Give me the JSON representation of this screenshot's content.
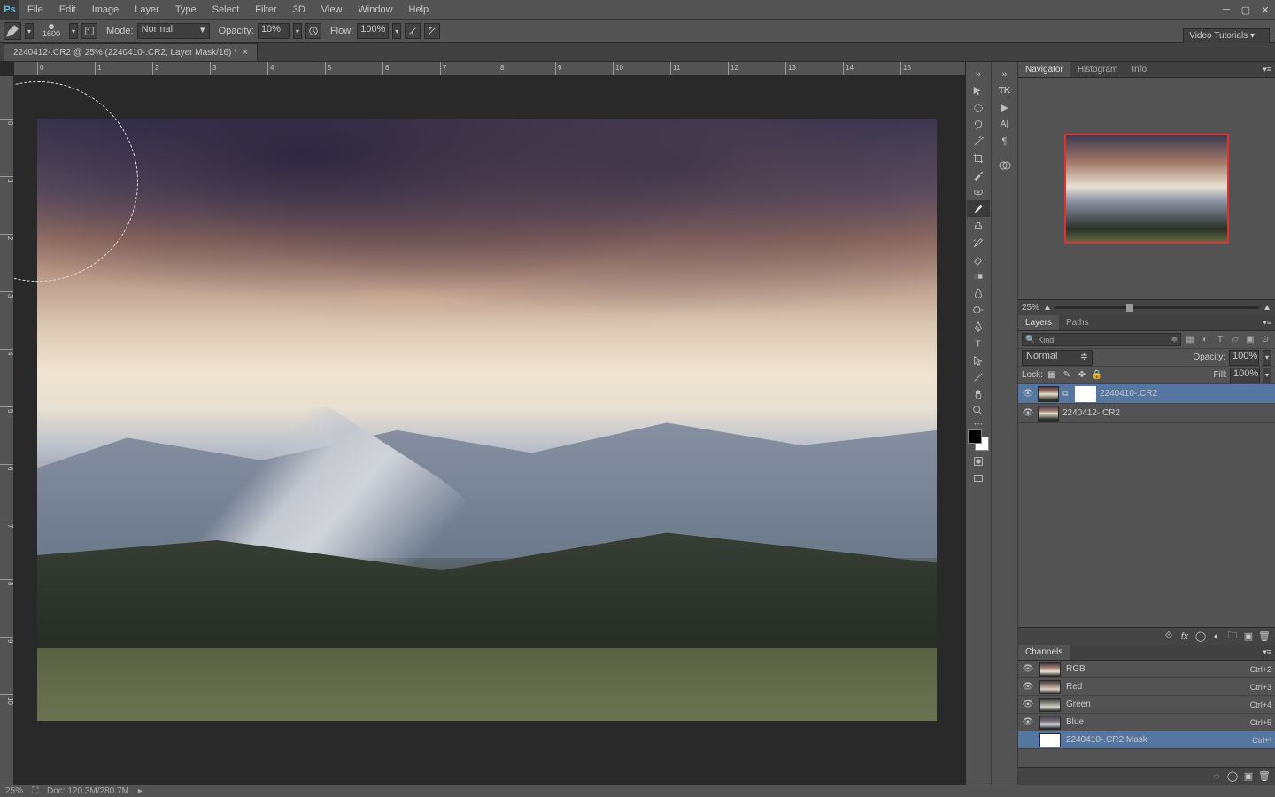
{
  "app": {
    "logo": "Ps"
  },
  "menu": [
    "File",
    "Edit",
    "Image",
    "Layer",
    "Type",
    "Select",
    "Filter",
    "3D",
    "View",
    "Window",
    "Help"
  ],
  "video_tutorials_label": "Video Tutorials",
  "options": {
    "brush_size": "1600",
    "mode_label": "Mode:",
    "mode_value": "Normal",
    "opacity_label": "Opacity:",
    "opacity_value": "10%",
    "flow_label": "Flow:",
    "flow_value": "100%"
  },
  "document": {
    "tab_title": "2240412-.CR2 @ 25% (2240410-.CR2, Layer Mask/16) *"
  },
  "navigator": {
    "tabs": [
      "Navigator",
      "Histogram",
      "Info"
    ],
    "zoom": "25%"
  },
  "layers_panel": {
    "tabs": [
      "Layers",
      "Paths"
    ],
    "filter_kind": "Kind",
    "blend_mode": "Normal",
    "opacity_label": "Opacity:",
    "opacity_value": "100%",
    "lock_label": "Lock:",
    "fill_label": "Fill:",
    "fill_value": "100%",
    "layers": [
      {
        "name": "2240410-.CR2",
        "selected": true,
        "has_mask": true
      },
      {
        "name": "2240412-.CR2",
        "selected": false,
        "has_mask": false
      }
    ]
  },
  "channels_panel": {
    "tab": "Channels",
    "rows": [
      {
        "name": "RGB",
        "shortcut": "Ctrl+2",
        "selected": false
      },
      {
        "name": "Red",
        "shortcut": "Ctrl+3",
        "selected": false
      },
      {
        "name": "Green",
        "shortcut": "Ctrl+4",
        "selected": false
      },
      {
        "name": "Blue",
        "shortcut": "Ctrl+5",
        "selected": false
      },
      {
        "name": "2240410-.CR2 Mask",
        "shortcut": "Ctrl+\\",
        "selected": true
      }
    ]
  },
  "status": {
    "zoom": "25%",
    "doc_info": "Doc: 120.3M/280.7M"
  },
  "tools": [
    "move",
    "marquee",
    "lasso",
    "wand",
    "crop",
    "eyedropper",
    "heal",
    "brush",
    "stamp",
    "history",
    "eraser",
    "gradient",
    "blur",
    "dodge",
    "pen",
    "type",
    "path",
    "shape",
    "hand",
    "zoom"
  ]
}
